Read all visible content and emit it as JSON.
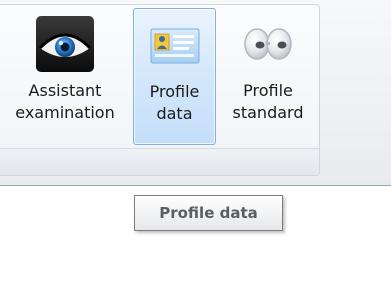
{
  "ribbon": {
    "buttons": [
      {
        "label_line1": "Assistant",
        "label_line2": "examination",
        "icon": "eye-icon",
        "state": "normal"
      },
      {
        "label_line1": "Profile",
        "label_line2": "data",
        "icon": "id-card-icon",
        "state": "hover"
      },
      {
        "label_line1": "Profile",
        "label_line2": "standard",
        "icon": "goggles-icon",
        "state": "normal"
      }
    ]
  },
  "tooltip": {
    "text": "Profile data"
  },
  "colors": {
    "hover_border": "#7fb0e6",
    "hover_fill": "#d5e8fb",
    "tooltip_text": "#5a5e63"
  }
}
